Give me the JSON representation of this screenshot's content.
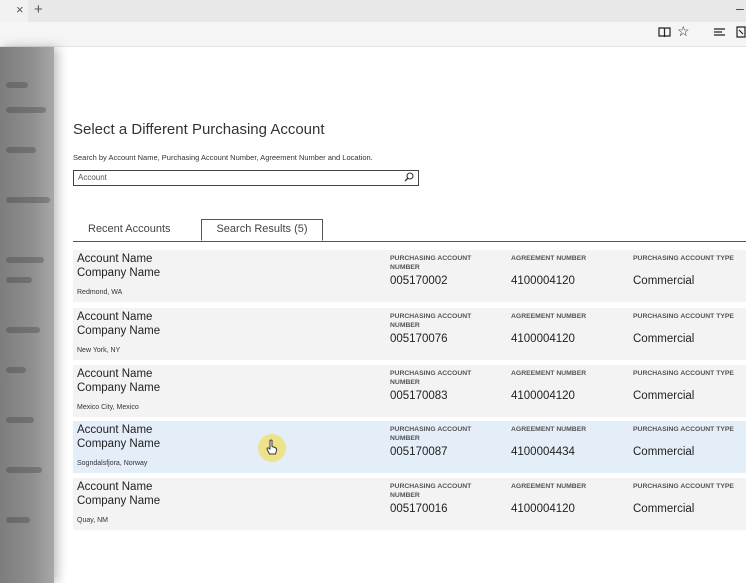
{
  "browser": {
    "tab_close_icon": "×",
    "new_tab_icon": "+",
    "minimize_icon": "–",
    "toolbar_icons": [
      "reading-view-icon",
      "favorite-star-icon",
      "hub-icon",
      "web-note-icon"
    ]
  },
  "page": {
    "title": "Select a Different Purchasing Account",
    "instructions": "Search by Account Name, Purchasing Account Number, Agreement Number and Location.",
    "search": {
      "placeholder": "Account",
      "value": ""
    },
    "tabs": [
      {
        "label": "Recent Accounts",
        "active": false
      },
      {
        "label": "Search Results (5)",
        "active": true
      }
    ],
    "columns": {
      "purchasing_account_number": "PURCHASING ACCOUNT NUMBER",
      "agreement_number": "AGREEMENT NUMBER",
      "purchasing_account_type": "PURCHASING ACCOUNT TYPE"
    },
    "results": [
      {
        "account_name": "Account Name",
        "company_name": "Company Name",
        "location": "Redmond, WA",
        "purchasing_account_number": "005170002",
        "agreement_number": "4100004120",
        "type": "Commercial"
      },
      {
        "account_name": "Account Name",
        "company_name": "Company Name",
        "location": "New York, NY",
        "purchasing_account_number": "005170076",
        "agreement_number": "4100004120",
        "type": "Commercial"
      },
      {
        "account_name": "Account Name",
        "company_name": "Company Name",
        "location": "Mexico City, Mexico",
        "purchasing_account_number": "005170083",
        "agreement_number": "4100004120",
        "type": "Commercial"
      },
      {
        "account_name": "Account Name",
        "company_name": "Company Name",
        "location": "Sogndalsfjora, Norway",
        "purchasing_account_number": "005170087",
        "agreement_number": "4100004434",
        "type": "Commercial"
      },
      {
        "account_name": "Account Name",
        "company_name": "Company Name",
        "location": "Quay, NM",
        "purchasing_account_number": "005170016",
        "agreement_number": "4100004120",
        "type": "Commercial"
      }
    ]
  },
  "colors": {
    "selected_row": "#e3eef8",
    "row": "#f3f3f3",
    "cursor_highlight": "#f0dc64"
  }
}
